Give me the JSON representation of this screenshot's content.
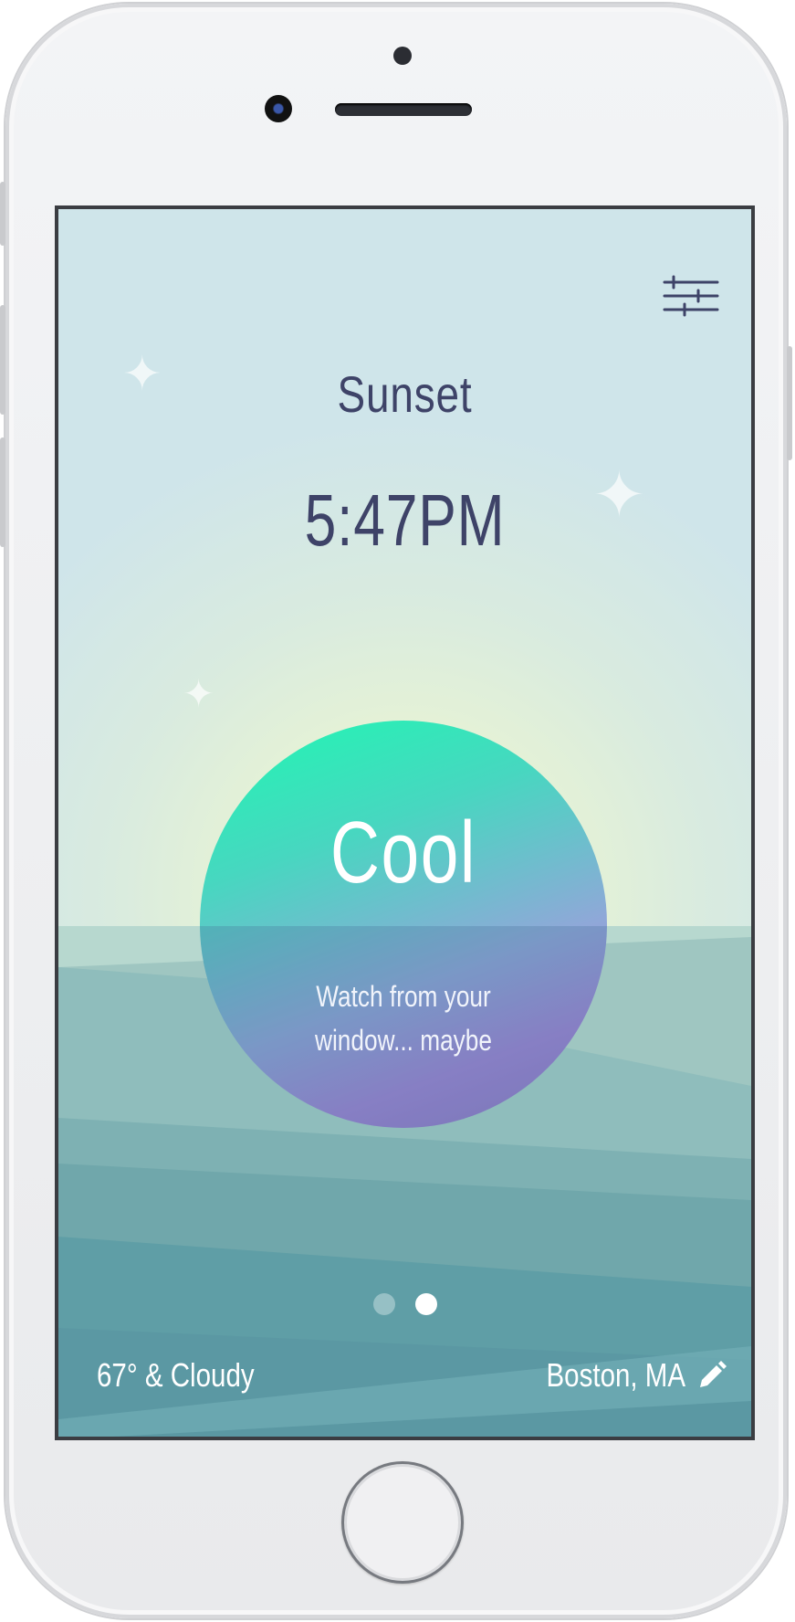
{
  "event": {
    "title": "Sunset",
    "time": "5:47PM"
  },
  "rating": {
    "label": "Cool",
    "message": "Watch from your window... maybe"
  },
  "pagination": {
    "pages": 2,
    "active_index": 1
  },
  "footer": {
    "weather": "67° & Cloudy",
    "location": "Boston, MA"
  },
  "icons": {
    "settings": "sliders-icon",
    "edit": "pencil-icon",
    "stars": "sparkle-icon"
  },
  "colors": {
    "text_primary": "#3e4368",
    "sky_top": "#cfe5ea",
    "sky_glow": "#eef6d2",
    "sea": "#6aa7ad",
    "sun_top": "#1ff8b2",
    "sun_bottom": "#a185d6"
  }
}
